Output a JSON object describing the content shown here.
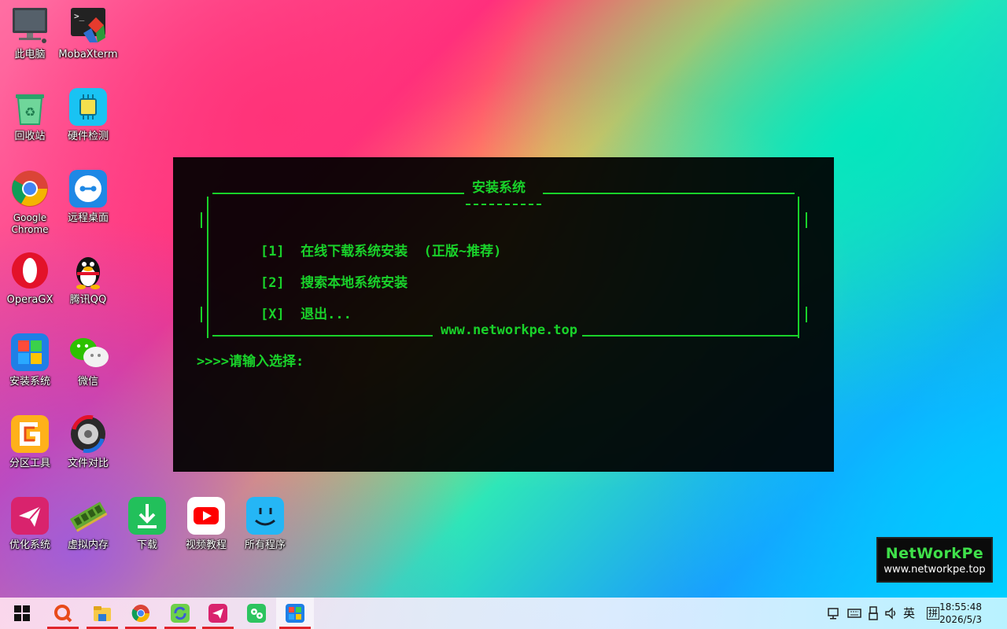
{
  "desktop_icons": [
    {
      "label": "此电脑",
      "icon": "computer-icon"
    },
    {
      "label": "MobaXterm",
      "icon": "mobaxterm-icon"
    },
    {
      "label": "回收站",
      "icon": "recycle-bin-icon"
    },
    {
      "label": "硬件检测",
      "icon": "chip-icon"
    },
    {
      "label": "Google Chrome",
      "icon": "chrome-icon"
    },
    {
      "label": "远程桌面",
      "icon": "remote-desktop-icon"
    },
    {
      "label": "OperaGX",
      "icon": "opera-icon"
    },
    {
      "label": "腾讯QQ",
      "icon": "qq-icon"
    },
    {
      "label": "安装系统",
      "icon": "windows-install-icon"
    },
    {
      "label": "微信",
      "icon": "wechat-icon"
    },
    {
      "label": "分区工具",
      "icon": "partition-tool-icon"
    },
    {
      "label": "文件对比",
      "icon": "file-compare-icon"
    },
    {
      "label": "优化系统",
      "icon": "optimize-icon"
    },
    {
      "label": "虚拟内存",
      "icon": "memory-icon"
    },
    {
      "label": "下载",
      "icon": "download-icon"
    },
    {
      "label": "视频教程",
      "icon": "youtube-icon"
    },
    {
      "label": "所有程序",
      "icon": "finder-icon"
    }
  ],
  "console": {
    "title": "安装系统",
    "option1_key": "[1]",
    "option1_text": "在线下载系统安装  (正版~推荐)",
    "option2_key": "[2]",
    "option2_text": "搜索本地系统安装",
    "optionx_key": "[X]",
    "optionx_text": "退出...",
    "footer": "www.networkpe.top",
    "prompt": ">>>>请输入选择:"
  },
  "logo": {
    "line1": "NetWorkPe",
    "line2": "www.networkpe.top"
  },
  "taskbar": {
    "apps": [
      "start-icon",
      "search-app-icon",
      "file-explorer-icon",
      "chrome-icon",
      "sync-app-icon",
      "telegram-like-icon",
      "wechat-work-icon",
      "install-system-icon"
    ],
    "ime_lang": "英",
    "ime_mode": "拼",
    "time": "18:55:48",
    "date": "2026/5/3"
  },
  "colors": {
    "console_text": "#19d22a",
    "underline_red": "#e0242b"
  }
}
